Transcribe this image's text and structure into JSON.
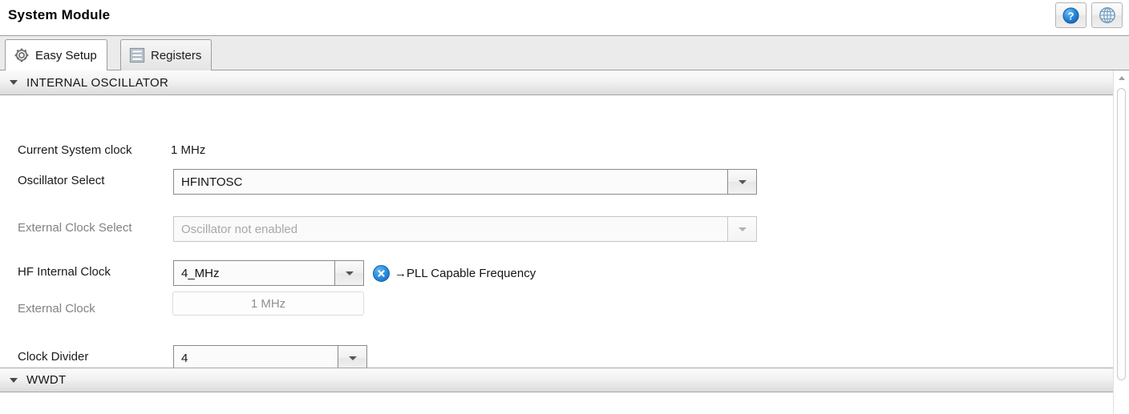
{
  "window": {
    "title": "System Module"
  },
  "titlebar_buttons": [
    {
      "name": "help-button",
      "icon": "help-icon",
      "tooltip": "Help"
    },
    {
      "name": "globe-button",
      "icon": "globe-icon",
      "tooltip": "Online"
    }
  ],
  "tabs": [
    {
      "label": "Easy Setup",
      "icon": "gear-icon",
      "active": true
    },
    {
      "label": "Registers",
      "icon": "registers-icon",
      "active": false
    }
  ],
  "sections": [
    {
      "id": "internal-oscillator",
      "title": "INTERNAL OSCILLATOR",
      "expanded": true,
      "fields": {
        "current_system_clock": {
          "label": "Current System clock",
          "value": "1 MHz"
        },
        "oscillator_select": {
          "label": "Oscillator Select",
          "value": "HFINTOSC",
          "disabled": false
        },
        "external_clock_select": {
          "label": "External Clock Select",
          "value": "Oscillator not enabled",
          "disabled": true
        },
        "hf_internal_clock": {
          "label": "HF Internal Clock",
          "value": "4_MHz",
          "disabled": false,
          "note": "→PLL Capable Frequency",
          "note_icon": "blue-x-badge-icon"
        },
        "external_clock": {
          "label": "External Clock",
          "value": "1 MHz",
          "disabled": true,
          "readonly": true
        },
        "clock_divider": {
          "label": "Clock Divider",
          "value": "4",
          "disabled": false
        }
      }
    },
    {
      "id": "wwdt",
      "title": "WWDT",
      "expanded": true
    }
  ],
  "colors": {
    "accent_blue": "#2a8fe0",
    "section_header_border": "#a6a6a6",
    "tab_border": "#9d9d9d",
    "disabled_text": "#a8a8a8"
  }
}
